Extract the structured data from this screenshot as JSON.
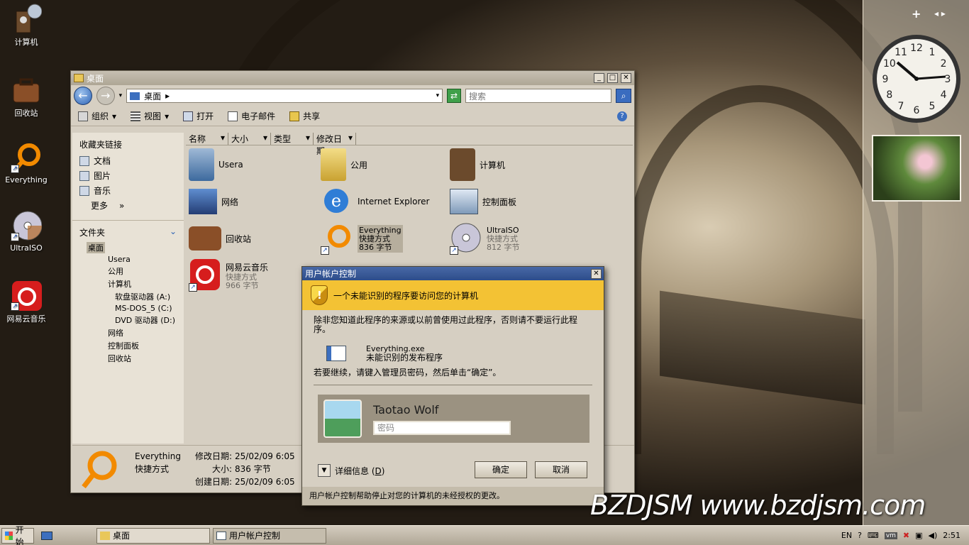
{
  "desktop": {
    "icons": [
      {
        "label": "计算机",
        "icon": "computer-icon"
      },
      {
        "label": "回收站",
        "icon": "recycle-bin-icon"
      },
      {
        "label": "Everything",
        "icon": "everything-icon"
      },
      {
        "label": "UltraISO",
        "icon": "disc-icon"
      },
      {
        "label": "网易云音乐",
        "icon": "netease-music-icon"
      }
    ]
  },
  "sidebar": {
    "add": "+",
    "clock": {
      "numbers": [
        "12",
        "1",
        "2",
        "3",
        "4",
        "5",
        "6",
        "7",
        "8",
        "9",
        "10",
        "11"
      ]
    }
  },
  "explorer": {
    "title": "桌面",
    "address": "桌面",
    "search_placeholder": "搜索",
    "toolbar": {
      "organize": "组织",
      "views": "视图",
      "open": "打开",
      "email": "电子邮件",
      "share": "共享"
    },
    "favorites_header": "收藏夹链接",
    "favorites": [
      "文档",
      "图片",
      "音乐",
      "更多"
    ],
    "more_arrow": "»",
    "folders_header": "文件夹",
    "tree": [
      "桌面",
      "Usera",
      "公用",
      "计算机",
      "软盘驱动器 (A:)",
      "MS-DOS_5 (C:)",
      "DVD 驱动器 (D:)",
      "网络",
      "控制面板",
      "回收站"
    ],
    "columns": [
      "名称",
      "大小",
      "类型",
      "修改日期"
    ],
    "items": [
      {
        "name": "Usera",
        "sub1": "",
        "sub2": ""
      },
      {
        "name": "公用",
        "sub1": "",
        "sub2": ""
      },
      {
        "name": "计算机",
        "sub1": "",
        "sub2": ""
      },
      {
        "name": "网络",
        "sub1": "",
        "sub2": ""
      },
      {
        "name": "Internet Explorer",
        "sub1": "",
        "sub2": ""
      },
      {
        "name": "控制面板",
        "sub1": "",
        "sub2": ""
      },
      {
        "name": "回收站",
        "sub1": "",
        "sub2": ""
      },
      {
        "name": "Everything",
        "sub1": "快捷方式",
        "sub2": "836 字节"
      },
      {
        "name": "UltraISO",
        "sub1": "快捷方式",
        "sub2": "812 字节"
      },
      {
        "name": "网易云音乐",
        "sub1": "快捷方式",
        "sub2": "966 字节"
      }
    ],
    "details": {
      "name": "Everything",
      "type": "快捷方式",
      "modified_label": "修改日期:",
      "modified": "25/02/09 6:05",
      "size_label": "大小:",
      "size": "836 字节",
      "created_label": "创建日期:",
      "created": "25/02/09 6:05"
    }
  },
  "uac": {
    "title": "用户帐户控制",
    "warning": "一个未能识别的程序要访问您的计算机",
    "body": "除非您知道此程序的来源或以前曾使用过此程序，否则请不要运行此程序。",
    "program": "Everything.exe",
    "publisher": "未能识别的发布程序",
    "prompt": "若要继续，请键入管理员密码，然后单击“确定”。",
    "user": "Taotao Wolf",
    "password_placeholder": "密码",
    "details": "详细信息",
    "details_key": "D",
    "ok": "确定",
    "cancel": "取消",
    "footer": "用户帐户控制帮助停止对您的计算机的未经授权的更改。"
  },
  "taskbar": {
    "start": "开始",
    "tasks": [
      "桌面",
      "用户帐户控制"
    ],
    "lang": "EN",
    "time": "2:51"
  },
  "watermark": "BZDJSM www.bzdjsm.com"
}
